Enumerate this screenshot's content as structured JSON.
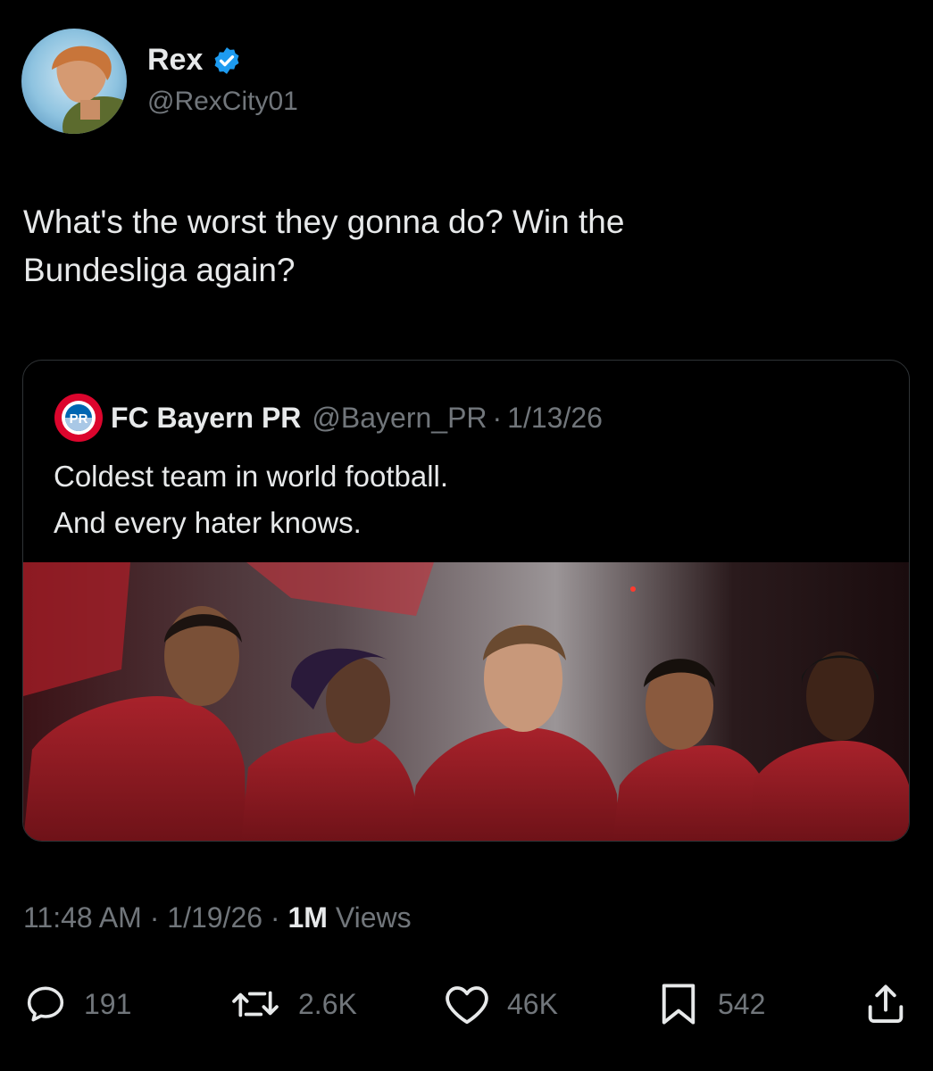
{
  "author": {
    "display_name": "Rex",
    "handle": "@RexCity01",
    "verified_badge_icon": "verified-badge-icon"
  },
  "tweet": {
    "text": "What's the worst they gonna do? Win the\nBundesliga again?"
  },
  "quoted_tweet": {
    "display_name": "FC Bayern PR",
    "handle": "@Bayern_PR",
    "separator": "·",
    "date": "1/13/26",
    "text": "Coldest team in world football.\nAnd every hater knows.",
    "logo_letters": "PR",
    "logo_ring_text_top": "FC BAYERN",
    "logo_ring_text_bottom": "MÜNCHEN"
  },
  "meta": {
    "time": "11:48 AM",
    "separator": "·",
    "date": "1/19/26",
    "views_count": "1M",
    "views_label": "Views"
  },
  "actions": {
    "reply": {
      "icon": "reply-icon",
      "count": "191"
    },
    "retweet": {
      "icon": "retweet-icon",
      "count": "2.6K"
    },
    "like": {
      "icon": "heart-icon",
      "count": "46K"
    },
    "bookmark": {
      "icon": "bookmark-icon",
      "count": "542"
    },
    "share": {
      "icon": "share-icon"
    }
  },
  "colors": {
    "background": "#000000",
    "text": "#e7e9ea",
    "muted": "#71767b",
    "border": "#2f3336",
    "verified": "#1d9bf0",
    "kit_red": "#8e1a22"
  }
}
